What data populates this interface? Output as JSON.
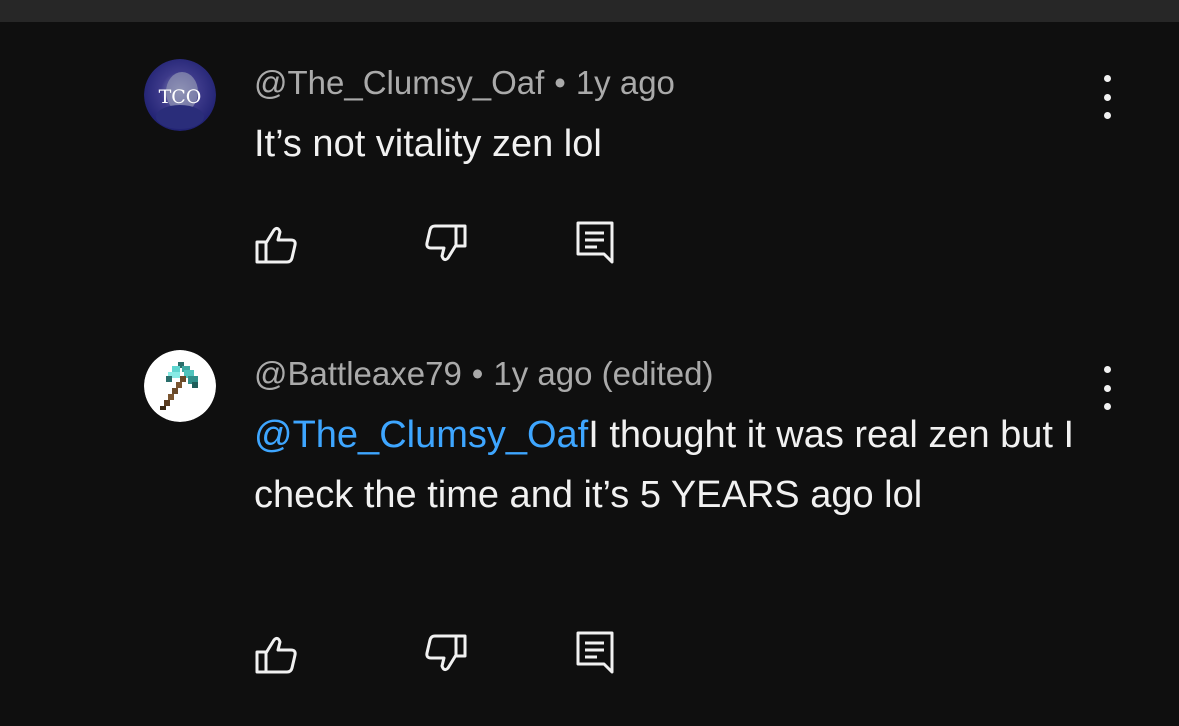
{
  "comments": [
    {
      "avatar_text": "TCO",
      "username": "@The_Clumsy_Oaf",
      "separator": "•",
      "time": "1y ago",
      "text": "It’s not vitality zen lol",
      "icons": [
        "thumb-up-icon",
        "thumb-down-icon",
        "reply-icon",
        "more-vert-icon"
      ]
    },
    {
      "avatar_icon": "diamond-axe-icon",
      "username": "@Battleaxe79",
      "separator": "•",
      "time": "1y ago (edited)",
      "mention": "@The_Clumsy_Oaf",
      "text": "I thought it was real zen but I check the time and it’s 5 YEARS ago lol",
      "icons": [
        "thumb-up-icon",
        "thumb-down-icon",
        "reply-icon",
        "more-vert-icon"
      ]
    }
  ],
  "colors": {
    "background": "#0f0f0f",
    "top_bar": "#272727",
    "text": "#f1f1f1",
    "meta": "#aaaaaa",
    "mention": "#3ea6ff"
  }
}
